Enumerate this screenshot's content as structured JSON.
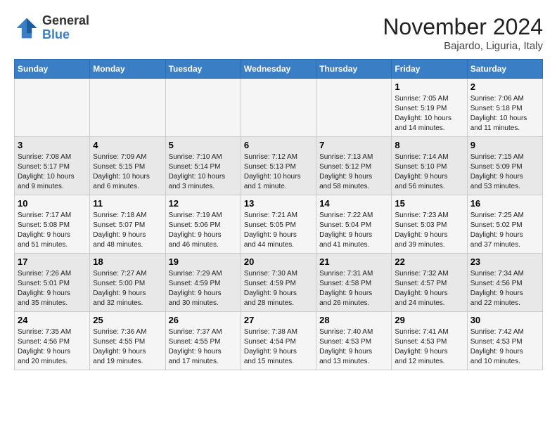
{
  "header": {
    "logo": {
      "general": "General",
      "blue": "Blue"
    },
    "month": "November 2024",
    "location": "Bajardo, Liguria, Italy"
  },
  "weekdays": [
    "Sunday",
    "Monday",
    "Tuesday",
    "Wednesday",
    "Thursday",
    "Friday",
    "Saturday"
  ],
  "weeks": [
    [
      {
        "day": "",
        "info": ""
      },
      {
        "day": "",
        "info": ""
      },
      {
        "day": "",
        "info": ""
      },
      {
        "day": "",
        "info": ""
      },
      {
        "day": "",
        "info": ""
      },
      {
        "day": "1",
        "info": "Sunrise: 7:05 AM\nSunset: 5:19 PM\nDaylight: 10 hours\nand 14 minutes."
      },
      {
        "day": "2",
        "info": "Sunrise: 7:06 AM\nSunset: 5:18 PM\nDaylight: 10 hours\nand 11 minutes."
      }
    ],
    [
      {
        "day": "3",
        "info": "Sunrise: 7:08 AM\nSunset: 5:17 PM\nDaylight: 10 hours\nand 9 minutes."
      },
      {
        "day": "4",
        "info": "Sunrise: 7:09 AM\nSunset: 5:15 PM\nDaylight: 10 hours\nand 6 minutes."
      },
      {
        "day": "5",
        "info": "Sunrise: 7:10 AM\nSunset: 5:14 PM\nDaylight: 10 hours\nand 3 minutes."
      },
      {
        "day": "6",
        "info": "Sunrise: 7:12 AM\nSunset: 5:13 PM\nDaylight: 10 hours\nand 1 minute."
      },
      {
        "day": "7",
        "info": "Sunrise: 7:13 AM\nSunset: 5:12 PM\nDaylight: 9 hours\nand 58 minutes."
      },
      {
        "day": "8",
        "info": "Sunrise: 7:14 AM\nSunset: 5:10 PM\nDaylight: 9 hours\nand 56 minutes."
      },
      {
        "day": "9",
        "info": "Sunrise: 7:15 AM\nSunset: 5:09 PM\nDaylight: 9 hours\nand 53 minutes."
      }
    ],
    [
      {
        "day": "10",
        "info": "Sunrise: 7:17 AM\nSunset: 5:08 PM\nDaylight: 9 hours\nand 51 minutes."
      },
      {
        "day": "11",
        "info": "Sunrise: 7:18 AM\nSunset: 5:07 PM\nDaylight: 9 hours\nand 48 minutes."
      },
      {
        "day": "12",
        "info": "Sunrise: 7:19 AM\nSunset: 5:06 PM\nDaylight: 9 hours\nand 46 minutes."
      },
      {
        "day": "13",
        "info": "Sunrise: 7:21 AM\nSunset: 5:05 PM\nDaylight: 9 hours\nand 44 minutes."
      },
      {
        "day": "14",
        "info": "Sunrise: 7:22 AM\nSunset: 5:04 PM\nDaylight: 9 hours\nand 41 minutes."
      },
      {
        "day": "15",
        "info": "Sunrise: 7:23 AM\nSunset: 5:03 PM\nDaylight: 9 hours\nand 39 minutes."
      },
      {
        "day": "16",
        "info": "Sunrise: 7:25 AM\nSunset: 5:02 PM\nDaylight: 9 hours\nand 37 minutes."
      }
    ],
    [
      {
        "day": "17",
        "info": "Sunrise: 7:26 AM\nSunset: 5:01 PM\nDaylight: 9 hours\nand 35 minutes."
      },
      {
        "day": "18",
        "info": "Sunrise: 7:27 AM\nSunset: 5:00 PM\nDaylight: 9 hours\nand 32 minutes."
      },
      {
        "day": "19",
        "info": "Sunrise: 7:29 AM\nSunset: 4:59 PM\nDaylight: 9 hours\nand 30 minutes."
      },
      {
        "day": "20",
        "info": "Sunrise: 7:30 AM\nSunset: 4:59 PM\nDaylight: 9 hours\nand 28 minutes."
      },
      {
        "day": "21",
        "info": "Sunrise: 7:31 AM\nSunset: 4:58 PM\nDaylight: 9 hours\nand 26 minutes."
      },
      {
        "day": "22",
        "info": "Sunrise: 7:32 AM\nSunset: 4:57 PM\nDaylight: 9 hours\nand 24 minutes."
      },
      {
        "day": "23",
        "info": "Sunrise: 7:34 AM\nSunset: 4:56 PM\nDaylight: 9 hours\nand 22 minutes."
      }
    ],
    [
      {
        "day": "24",
        "info": "Sunrise: 7:35 AM\nSunset: 4:56 PM\nDaylight: 9 hours\nand 20 minutes."
      },
      {
        "day": "25",
        "info": "Sunrise: 7:36 AM\nSunset: 4:55 PM\nDaylight: 9 hours\nand 19 minutes."
      },
      {
        "day": "26",
        "info": "Sunrise: 7:37 AM\nSunset: 4:55 PM\nDaylight: 9 hours\nand 17 minutes."
      },
      {
        "day": "27",
        "info": "Sunrise: 7:38 AM\nSunset: 4:54 PM\nDaylight: 9 hours\nand 15 minutes."
      },
      {
        "day": "28",
        "info": "Sunrise: 7:40 AM\nSunset: 4:53 PM\nDaylight: 9 hours\nand 13 minutes."
      },
      {
        "day": "29",
        "info": "Sunrise: 7:41 AM\nSunset: 4:53 PM\nDaylight: 9 hours\nand 12 minutes."
      },
      {
        "day": "30",
        "info": "Sunrise: 7:42 AM\nSunset: 4:53 PM\nDaylight: 9 hours\nand 10 minutes."
      }
    ]
  ]
}
